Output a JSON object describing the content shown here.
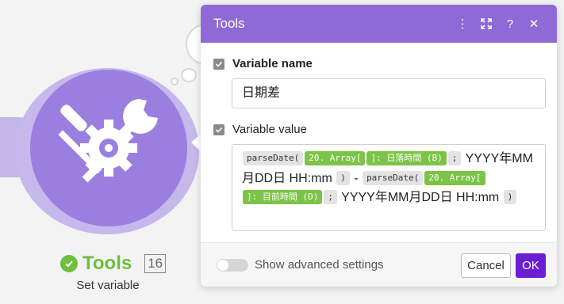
{
  "module": {
    "name": "Tools",
    "count": "16",
    "subtitle": "Set variable",
    "icon": "wrench-screwdriver-gear-icon",
    "colors": {
      "node": "#9b7fe0",
      "node_ring": "#c7b8ec",
      "status": "#6fbf3f"
    }
  },
  "dialog": {
    "title": "Tools",
    "header_icons": [
      "more-vertical-icon",
      "expand-icon",
      "help-icon",
      "close-icon"
    ],
    "header_glyphs": {
      "more": "⋮",
      "help": "?",
      "close": "✕"
    },
    "variable_name": {
      "label": "Variable name",
      "value": "日期差"
    },
    "variable_value": {
      "label": "Variable value",
      "tokens": {
        "fn1": "parseDate(",
        "var1": "20. Array[",
        "var2": "]: 日落時間 (B)",
        "sep1": ";",
        "text1": " YYYY年MM月DD日 HH:mm ",
        "close1": ")",
        "minus": " - ",
        "fn2": "parseDate(",
        "var3": "20. Array[",
        "var4": "]: 目前時間 (D)",
        "sep2": ";",
        "text2": " YYYY年MM月DD日 HH:mm ",
        "close2": ")"
      }
    },
    "footer": {
      "advanced_label": "Show advanced settings",
      "cancel_label": "Cancel",
      "ok_label": "OK"
    },
    "colors": {
      "header": "#8f6ad6",
      "ok": "#6a1fd0",
      "var_token": "#7bc447"
    }
  }
}
